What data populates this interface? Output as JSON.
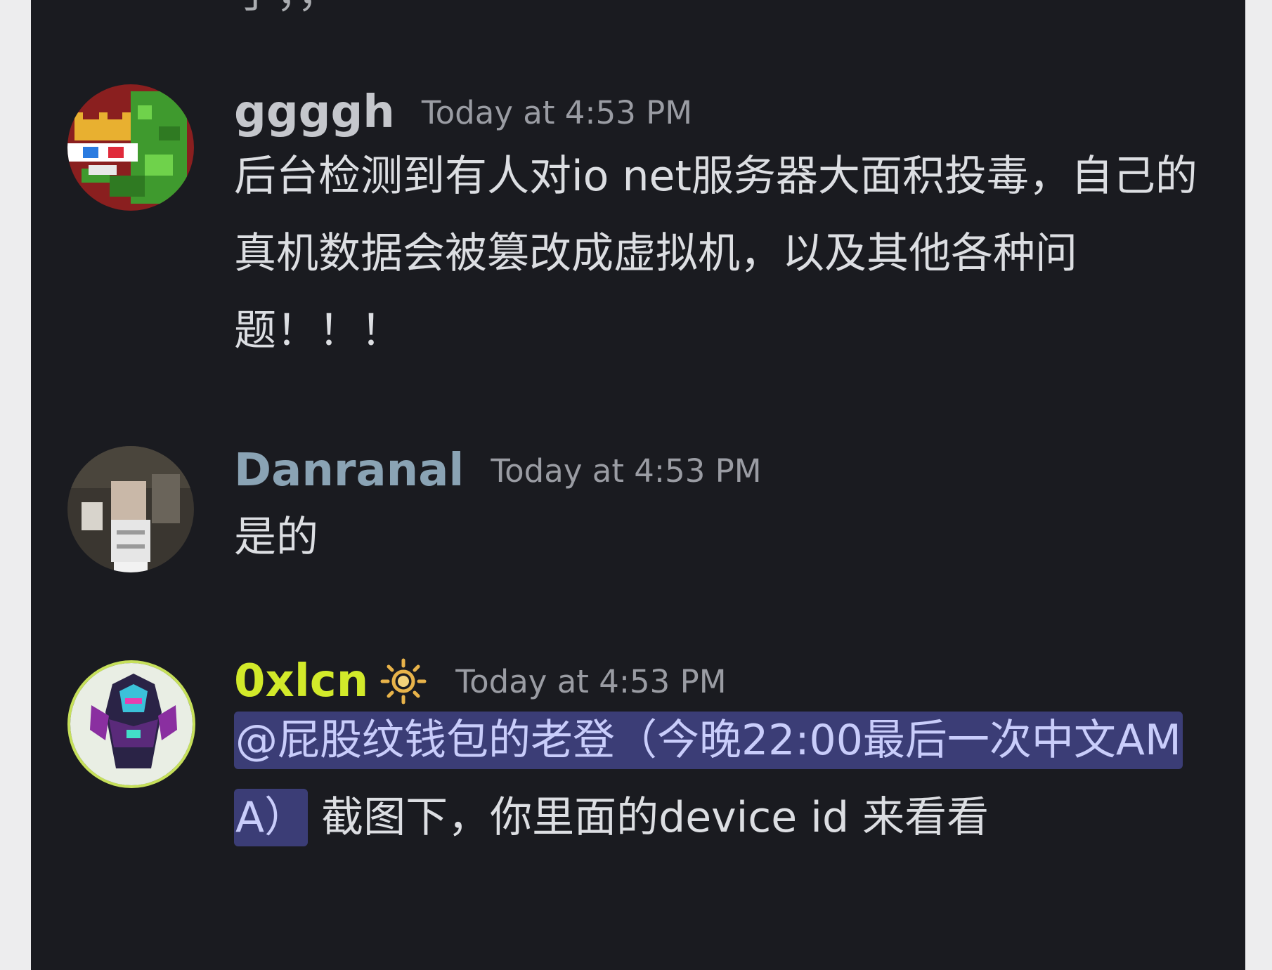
{
  "clipped_previous_line": "了，，",
  "messages": [
    {
      "username": "ggggh",
      "username_color": "#c5c7cc",
      "timestamp": "Today at 4:53 PM",
      "text": "后台检测到有人对io net服务器大面积投毒，自己的真机数据会被篡改成虚拟机，以及其他各种问题！！！"
    },
    {
      "username": "Danranal",
      "username_color": "#8aa3b4",
      "timestamp": "Today at 4:53 PM",
      "text": "是的"
    },
    {
      "username": "0xlcn",
      "username_color": "#d2ea2a",
      "status_icon": "sun-icon",
      "timestamp": "Today at 4:53 PM",
      "mention": "@屁股纹钱包的老登（今晚22:00最后一次中文AMA）",
      "text": " 截图下，你里面的device id 来看看"
    }
  ],
  "colors": {
    "background": "#1a1b20",
    "text": "#dcdee2",
    "timestamp": "#9a9ca3",
    "mention_bg": "#3b3d76",
    "mention_text": "#c9cdfb"
  }
}
